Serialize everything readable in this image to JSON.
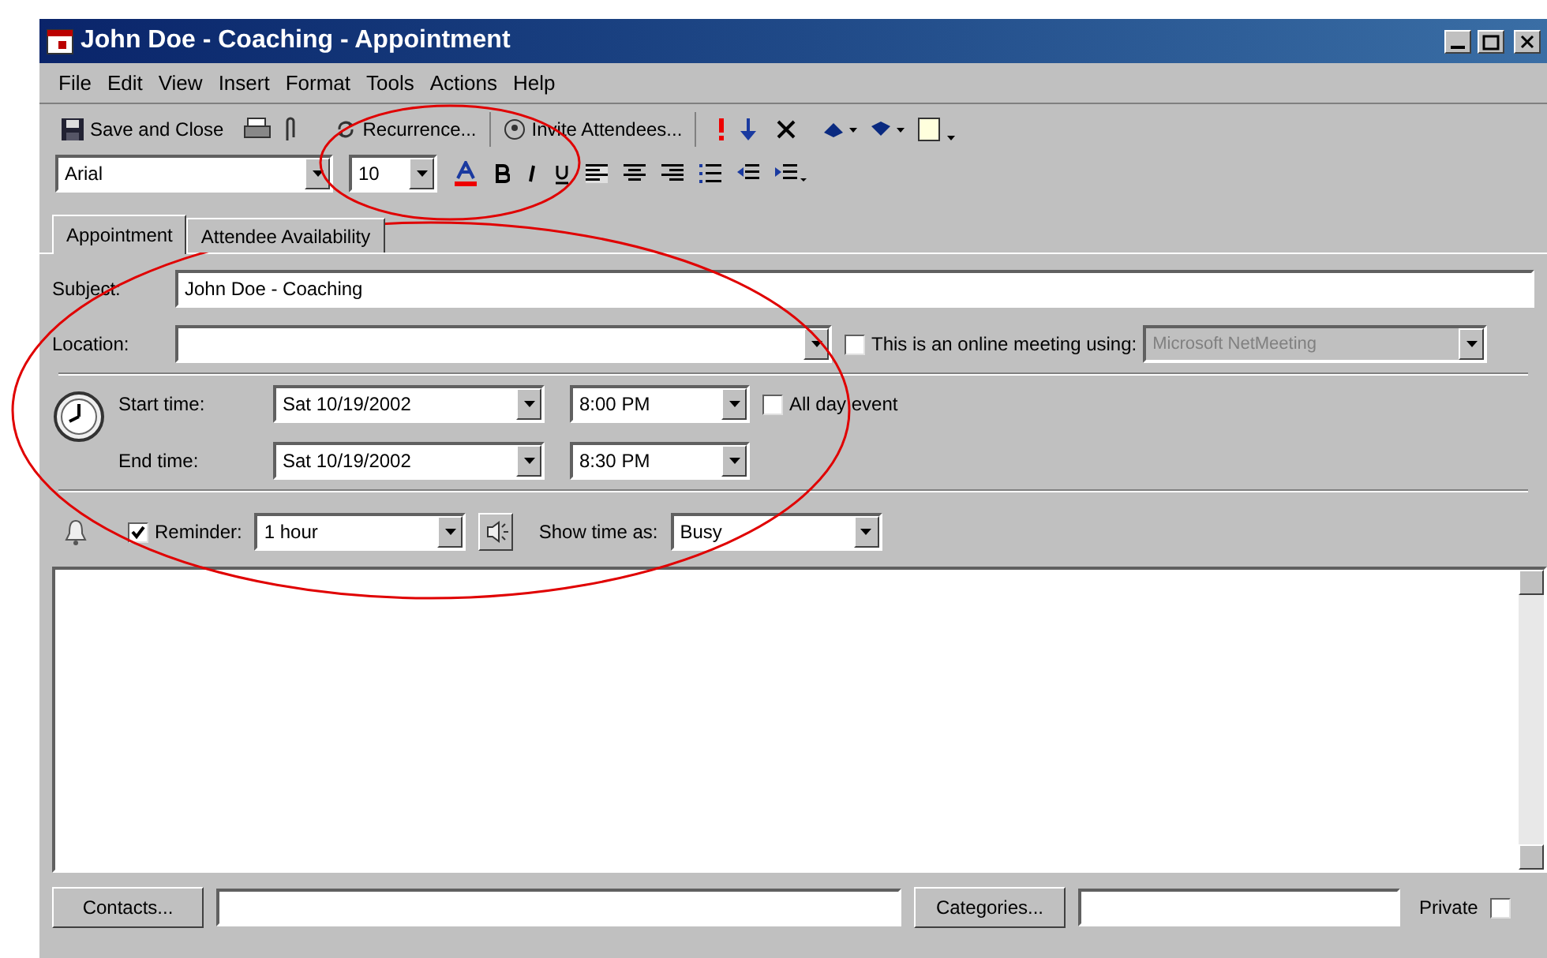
{
  "window": {
    "title": "John Doe - Coaching - Appointment"
  },
  "menu": [
    "File",
    "Edit",
    "View",
    "Insert",
    "Format",
    "Tools",
    "Actions",
    "Help"
  ],
  "toolbar": {
    "save_close": "Save and Close",
    "recurrence": "Recurrence...",
    "invite": "Invite Attendees..."
  },
  "format_bar": {
    "font": "Arial",
    "size": "10"
  },
  "tabs": [
    {
      "label": "Appointment",
      "selected": true
    },
    {
      "label": "Attendee Availability",
      "selected": false
    }
  ],
  "subject": {
    "label": "Subject:",
    "value": "John Doe - Coaching"
  },
  "location": {
    "label": "Location:"
  },
  "online_meeting": {
    "label": "This is an online meeting using:",
    "checked": false,
    "value": "Microsoft NetMeeting",
    "disabled": true
  },
  "start": {
    "label": "Start time:",
    "date": "Sat 10/19/2002",
    "time": "8:00 PM"
  },
  "end": {
    "label": "End time:",
    "date": "Sat 10/19/2002",
    "time": "8:30 PM"
  },
  "all_day": {
    "label": "All day event",
    "checked": false
  },
  "reminder": {
    "label": "Reminder:",
    "checked": true,
    "value": "1 hour"
  },
  "show_time_as": {
    "label": "Show time as:",
    "value": "Busy"
  },
  "footer": {
    "contacts": "Contacts...",
    "categories": "Categories...",
    "private": {
      "label": "Private",
      "checked": false
    }
  }
}
